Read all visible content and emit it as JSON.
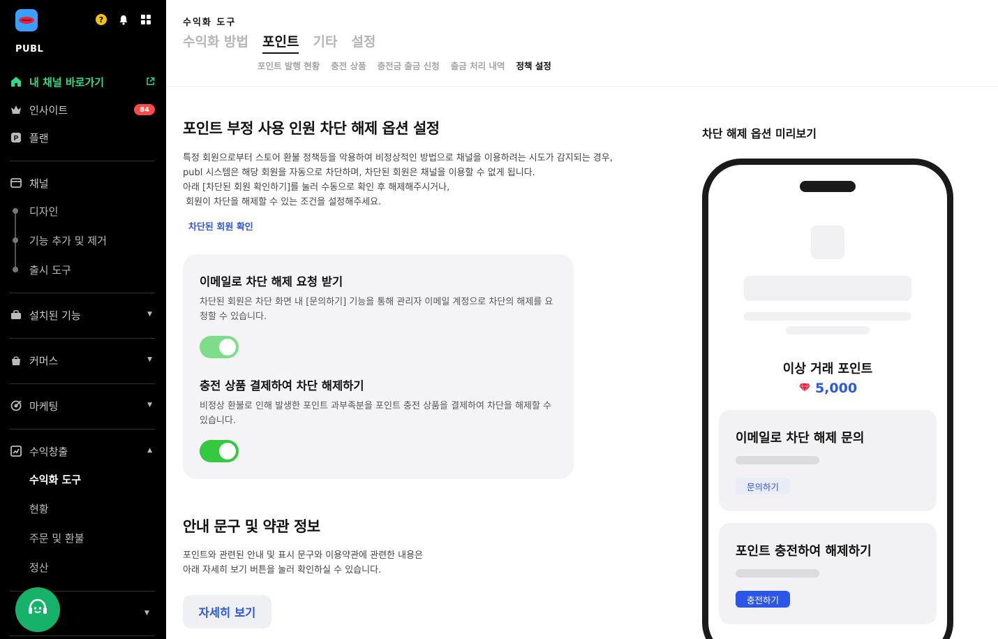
{
  "sidebar": {
    "brand": "PUBL",
    "help_glyph": "?",
    "nav": {
      "my_channel": "내 채널 바로가기",
      "insight": "인사이트",
      "insight_badge": "84",
      "plan": "플랜",
      "channel": "채널",
      "design": "디자인",
      "features": "기능 추가 및 제거",
      "release": "출시 도구",
      "installed": "설치된 기능",
      "commerce": "커머스",
      "marketing": "마케팅",
      "monetization": "수익창출",
      "sub": {
        "tools": "수익화 도구",
        "status": "현황",
        "orders": "주문 및 환불",
        "settlement": "정산"
      }
    }
  },
  "header": {
    "breadcrumb": "수익화 도구",
    "tabs": [
      "수익화 방법",
      "포인트",
      "기타",
      "설정"
    ],
    "active_tab": "포인트",
    "sub_tabs": [
      "포인트 발행 현황",
      "충전 상품",
      "충전금 출금 신청",
      "출금 처리 내역",
      "정책 설정"
    ],
    "active_sub_tab": "정책 설정"
  },
  "main": {
    "title": "포인트 부정 사용 인원 차단 해제 옵션 설정",
    "description": [
      "특정 회원으로부터 스토어 환불 정책등을 악용하여 비정상적인 방법으로 채널을 이용하려는 시도가 감지되는 경우,",
      "publ 시스템은 해당 회원을 자동으로 차단하며, 차단된 회원은 채널을 이용할 수 없게 됩니다.",
      "아래 [차단된 회원 확인하기]를 눌러 수동으로 확인 후 해제해주시거나,",
      " 회원이 차단을 해제할 수 있는 조건을 설정해주세요."
    ],
    "blocked_link": "차단된 회원 확인",
    "options": [
      {
        "title": "이메일로 차단 해제 요청 받기",
        "description": "차단된 회원은 차단 화면 내 [문의하기] 기능을 통해 관리자 이메일 계정으로 차단의 해제를 요청할 수 있습니다.",
        "enabled": true
      },
      {
        "title": "충전 상품 결제하여 차단 해제하기",
        "description": "비정상 환불로 인해 발생한 포인트 과부족분을 포인트 충전 상품을 결제하여 차단을 해제할 수 있습니다.",
        "enabled": true
      }
    ],
    "terms_title": "안내 문구 및 약관 정보",
    "terms_description": [
      "포인트와 관련된 안내 및 표시 문구와 이용약관에 관련한 내용은",
      "아래 자세히 보기 버튼을 눌러 확인하실 수 있습니다."
    ],
    "more_button": "자세히 보기"
  },
  "preview": {
    "title": "차단 해제 옵션 미리보기",
    "label": "이상 거래 포인트",
    "points": "5,000",
    "cards": [
      {
        "title": "이메일로 차단 해제 문의",
        "button": "문의하기"
      },
      {
        "title": "포인트 충전하여 해제하기",
        "button": "충전하기"
      }
    ]
  },
  "colors": {
    "accent_green": "#2fdc82",
    "accent_blue": "#2b56e8",
    "toggle_on": "#34c93f",
    "badge_red": "#ff4a4a"
  }
}
